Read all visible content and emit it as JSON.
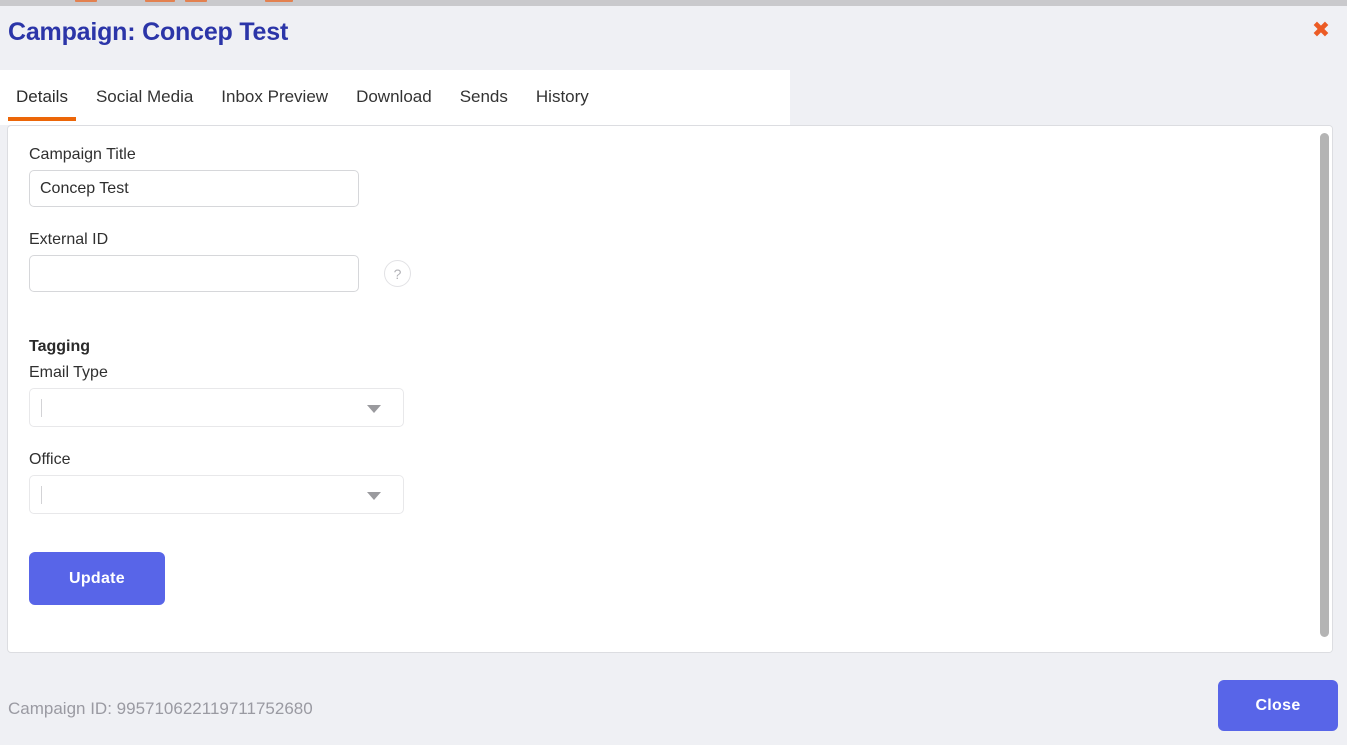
{
  "window": {
    "background_color": "#eff0f4",
    "panel_color": "#ffffff"
  },
  "header": {
    "title": "Campaign: Concep Test",
    "title_color": "#2b35a8",
    "close_icon": "close-x-icon",
    "close_icon_glyph": "✖",
    "close_icon_color": "#ec5b24"
  },
  "tabs": {
    "active_index": 0,
    "active_underline_color": "#ec6608",
    "items": [
      {
        "label": "Details"
      },
      {
        "label": "Social Media"
      },
      {
        "label": "Inbox Preview"
      },
      {
        "label": "Download"
      },
      {
        "label": "Sends"
      },
      {
        "label": "History"
      }
    ]
  },
  "form": {
    "campaign_title": {
      "label": "Campaign Title",
      "value": "Concep Test",
      "placeholder": ""
    },
    "external_id": {
      "label": "External ID",
      "value": "",
      "placeholder": "",
      "help_icon": "question-mark-icon",
      "help_glyph": "?"
    },
    "tagging": {
      "heading": "Tagging",
      "email_type": {
        "label": "Email Type",
        "selected": "",
        "arrow_icon": "chevron-down-icon"
      },
      "office": {
        "label": "Office",
        "selected": "",
        "arrow_icon": "chevron-down-icon"
      }
    },
    "update_button": {
      "label": "Update",
      "color": "#5865e8"
    }
  },
  "footer": {
    "campaign_id_text": "Campaign ID: 995710622119711752680",
    "close_button": {
      "label": "Close",
      "color": "#5865e8"
    }
  }
}
